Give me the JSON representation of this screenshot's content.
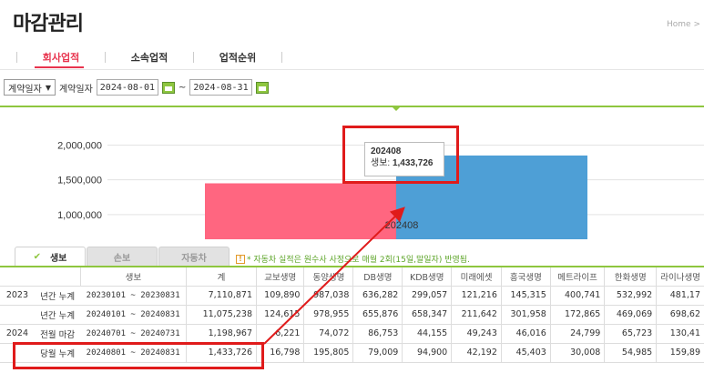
{
  "header": {
    "title": "마감관리",
    "breadcrumb": "Home >"
  },
  "top_tabs": [
    {
      "label": "회사업적",
      "active": true
    },
    {
      "label": "소속업적",
      "active": false
    },
    {
      "label": "업적순위",
      "active": false
    }
  ],
  "filter": {
    "date_type": "계약일자",
    "date_label": "계약일자",
    "start_date": "2024-08-01",
    "separator": "~",
    "end_date": "2024-08-31"
  },
  "chart_data": {
    "type": "bar",
    "categories": [
      "202408"
    ],
    "y_ticks": [
      "2,000,000",
      "1,500,000",
      "1,000,000"
    ],
    "ylim": [
      750000,
      2150000
    ],
    "series": [
      {
        "values": [
          1450000
        ],
        "color": "#ff6680"
      },
      {
        "name": "생보",
        "values": [
          1850000
        ],
        "color": "#4e9fd6"
      }
    ],
    "grid": true
  },
  "tooltip": {
    "period": "202408",
    "label": "생보:",
    "value": "1,433,726"
  },
  "sub_tabs": [
    {
      "label": "생보",
      "active": true
    },
    {
      "label": "손보",
      "active": false
    },
    {
      "label": "자동차",
      "active": false
    }
  ],
  "notice": "* 자동차 실적은 원수사 사정으로 매월 2회(15일,말일자) 반영됨.",
  "table": {
    "headers": [
      "",
      "",
      "생보",
      "계",
      "교보생명",
      "동양생명",
      "DB생명",
      "KDB생명",
      "미래에셋",
      "흥국생명",
      "메트라이프",
      "한화생명",
      "라이나생명"
    ],
    "rows": [
      [
        "2023",
        "년간 누계",
        "20230101 ~ 20230831",
        "7,110,871",
        "109,890",
        "987,038",
        "636,282",
        "299,057",
        "121,216",
        "145,315",
        "400,741",
        "532,992",
        "481,17"
      ],
      [
        "",
        "년간 누계",
        "20240101 ~ 20240831",
        "11,075,238",
        "124,615",
        "978,955",
        "655,876",
        "658,347",
        "211,642",
        "301,958",
        "172,865",
        "469,069",
        "698,62"
      ],
      [
        "2024",
        "전월 마감",
        "20240701 ~ 20240731",
        "1,198,967",
        "6,221",
        "74,072",
        "86,753",
        "44,155",
        "49,243",
        "46,016",
        "24,799",
        "65,723",
        "130,41"
      ],
      [
        "",
        "당월 누계",
        "20240801 ~ 20240831",
        "1,433,726",
        "16,798",
        "195,805",
        "79,009",
        "94,900",
        "42,192",
        "45,403",
        "30,008",
        "54,985",
        "159,89"
      ]
    ]
  }
}
